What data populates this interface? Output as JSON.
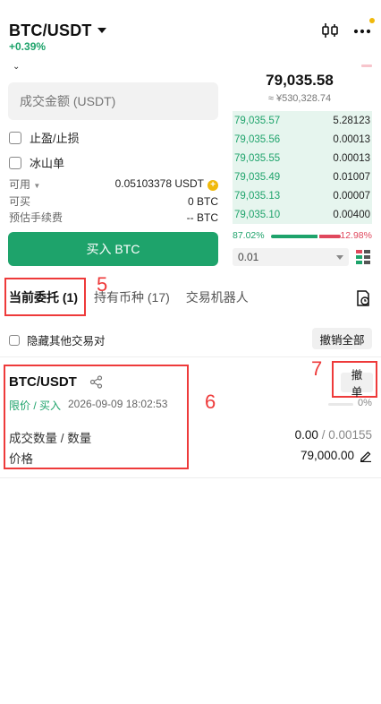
{
  "header": {
    "pair": "BTC/USDT",
    "change": "+0.39%",
    "icons": [
      "candlestick-chart-icon",
      "more-icon"
    ]
  },
  "form": {
    "amount_placeholder": "成交金额 (USDT)",
    "options": [
      "止盈/止损",
      "冰山单"
    ],
    "available_label": "可用",
    "available_value": "0.05103378 USDT",
    "can_buy_label": "可买",
    "can_buy_value": "0 BTC",
    "fee_label": "预估手续费",
    "fee_value": "-- BTC",
    "buy_button": "买入 BTC"
  },
  "orderbook": {
    "last_price": "79,035.58",
    "fiat_price": "≈ ¥530,328.74",
    "bids": [
      {
        "price": "79,035.57",
        "qty": "5.28123"
      },
      {
        "price": "79,035.56",
        "qty": "0.00013"
      },
      {
        "price": "79,035.55",
        "qty": "0.00013"
      },
      {
        "price": "79,035.49",
        "qty": "0.01007"
      },
      {
        "price": "79,035.13",
        "qty": "0.00007"
      },
      {
        "price": "79,035.10",
        "qty": "0.00400"
      }
    ],
    "buy_ratio": "87.02%",
    "sell_ratio": "12.98%",
    "buy_ratio_value": 87.02,
    "precision": "0.01"
  },
  "tabs": [
    {
      "label": "当前委托 (1)"
    },
    {
      "label": "持有币种 (17)"
    },
    {
      "label": "交易机器人"
    }
  ],
  "filters": {
    "hide_other_pairs": "隐藏其他交易对",
    "cancel_all": "撤销全部"
  },
  "order": {
    "pair": "BTC/USDT",
    "side": "限价 / 买入",
    "time": "2026-09-09 18:02:53",
    "cancel": "撤单",
    "progress_pct": "0%",
    "filled_label": "成交数量 / 数量",
    "filled_value": "0.00",
    "amount_value": " / 0.00155",
    "price_label": "价格",
    "price_value": "79,000.00"
  },
  "annotations": {
    "num5": "5",
    "num6": "6",
    "num7": "7"
  },
  "colors": {
    "green": "#1ea36b",
    "red": "#e0485d",
    "annotation_red": "#ee3a3a",
    "accent": "#f0b90b"
  }
}
